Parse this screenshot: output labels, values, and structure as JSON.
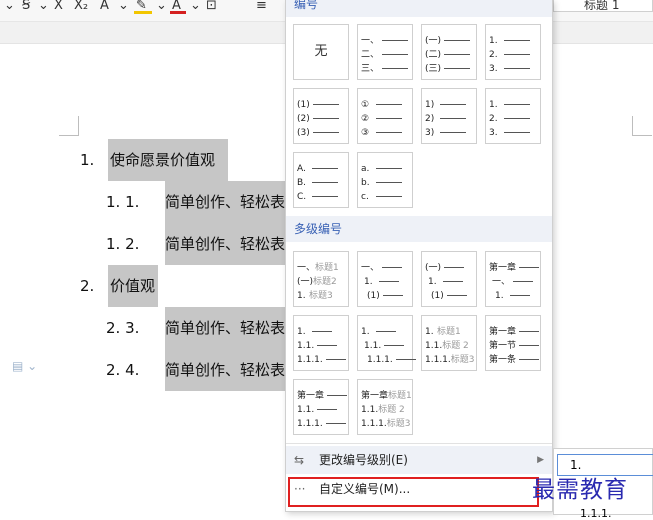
{
  "toolbar": {
    "items": [
      {
        "glyph": "⌄"
      },
      {
        "glyph": "="
      },
      {
        "glyph": "⌄"
      },
      {
        "glyph": "X"
      },
      {
        "glyph": "X₂"
      },
      {
        "glyph": "A"
      },
      {
        "glyph": "⌄"
      },
      {
        "glyph": "A"
      },
      {
        "glyph": "⌄"
      },
      {
        "glyph": "A"
      },
      {
        "glyph": "⌄"
      },
      {
        "glyph": "A"
      },
      {
        "glyph": "A"
      }
    ],
    "style_label": "标题 1",
    "highlight_color": "#f2c600",
    "font_color": "#d42020"
  },
  "document": {
    "lines": [
      {
        "num": "1.",
        "text": "使命愿景价值观"
      },
      {
        "num": "1. 1.",
        "text": "简单创作、轻松表"
      },
      {
        "num": "1. 2.",
        "text": "简单创作、轻松表"
      },
      {
        "num": "2.",
        "text": "价值观"
      },
      {
        "num": "2. 3.",
        "text": "简单创作、轻松表"
      },
      {
        "num": "2. 4.",
        "text": "简单创作、轻松表"
      }
    ]
  },
  "panel": {
    "section_numbering": "编号",
    "none_label": "无",
    "numbering_tiles": [
      [
        "一、",
        "二、",
        "三、"
      ],
      [
        "(一)",
        "(二)",
        "(三)"
      ],
      [
        "1.",
        "2.",
        "3."
      ],
      [
        "(1)",
        "(2)",
        "(3)"
      ],
      [
        "①",
        "②",
        "③"
      ],
      [
        "1)",
        "2)",
        "3)"
      ],
      [
        "1.",
        "2.",
        "3."
      ],
      [
        "A.",
        "B.",
        "C."
      ],
      [
        "a.",
        "b.",
        "c."
      ]
    ],
    "section_multilevel": "多级编号",
    "multilevel_tiles": [
      [
        {
          "m": "一、",
          "t": "标题1"
        },
        {
          "m": "(一)",
          "t": "标题2"
        },
        {
          "m": "1.",
          "t": "标题3"
        }
      ],
      [
        {
          "m": "一、",
          "t": ""
        },
        {
          "m": "1.",
          "t": ""
        },
        {
          "m": "(1)",
          "t": ""
        }
      ],
      [
        {
          "m": "(一)",
          "t": ""
        },
        {
          "m": "1.",
          "t": ""
        },
        {
          "m": "(1)",
          "t": ""
        }
      ],
      [
        {
          "m": "第一章",
          "t": ""
        },
        {
          "m": "一、",
          "t": ""
        },
        {
          "m": "1.",
          "t": ""
        }
      ],
      [
        {
          "m": "1.",
          "t": ""
        },
        {
          "m": "1.1.",
          "t": ""
        },
        {
          "m": "1.1.1.",
          "t": ""
        }
      ],
      [
        {
          "m": "1.",
          "t": ""
        },
        {
          "m": "1.1.",
          "t": ""
        },
        {
          "m": "1.1.1.",
          "t": ""
        }
      ],
      [
        {
          "m": "1.",
          "t": "标题1"
        },
        {
          "m": "1.1.",
          "t": "标题 2"
        },
        {
          "m": "1.1.1.",
          "t": "标题3"
        }
      ],
      [
        {
          "m": "第一章",
          "t": ""
        },
        {
          "m": "第一节",
          "t": ""
        },
        {
          "m": "第一条",
          "t": ""
        }
      ],
      [
        {
          "m": "第一章",
          "t": ""
        },
        {
          "m": "1.1.",
          "t": ""
        },
        {
          "m": "1.1.1.",
          "t": ""
        }
      ],
      [
        {
          "m": "第一章",
          "t": "标题1"
        },
        {
          "m": "1.1.",
          "t": "标题 2"
        },
        {
          "m": "1.1.1.",
          "t": "标题3"
        }
      ]
    ],
    "change_level_label": "更改编号级别(E)",
    "custom_label": "自定义编号(M)..."
  },
  "side_preview": {
    "first": "1.",
    "last": "1.1.1."
  },
  "watermark": "最需教育",
  "colors": {
    "accent": "#3a62b5",
    "highlight": "#c6c6c6",
    "annotation": "#e02020",
    "watermark": "#2a2ab0"
  }
}
